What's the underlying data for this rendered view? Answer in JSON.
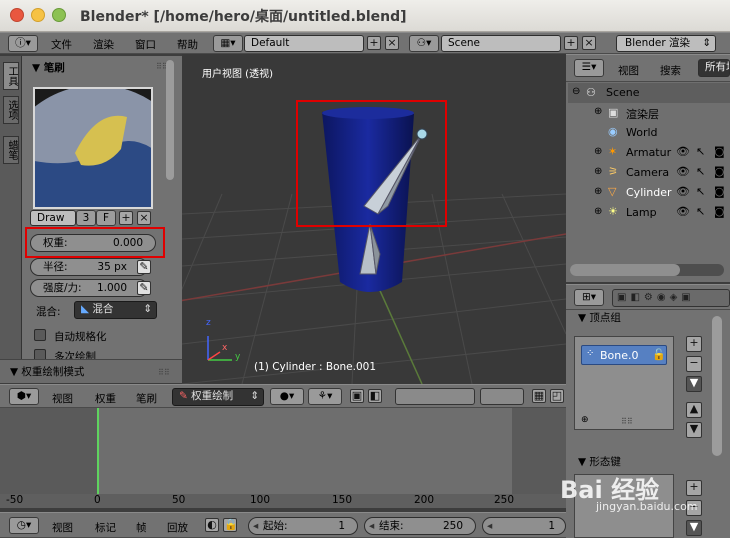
{
  "window": {
    "title": "Blender* [/home/hero/桌面/untitled.blend]"
  },
  "top_menu": {
    "items": [
      "文件",
      "渲染",
      "窗口",
      "帮助"
    ],
    "layout": "Default",
    "scene": "Scene",
    "engine": "Blender 渲染"
  },
  "tool_shelf": {
    "tabs": [
      "工具",
      "选项",
      "蜡笔"
    ],
    "brush_panel": "笔刷",
    "brush_name": "Draw",
    "brush_users": "3",
    "brush_fake": "F",
    "weight": {
      "label": "权重:",
      "value": "0.000"
    },
    "radius": {
      "label": "半径:",
      "value": "35 px"
    },
    "strength": {
      "label": "强度/力:",
      "value": "1.000"
    },
    "blend": {
      "label": "混合:",
      "value": "混合"
    },
    "auto_normalize": "自动规格化",
    "multi_paint": "多次绘制",
    "mode_panel": "权重绘制模式"
  },
  "viewport": {
    "view_label": "用户视图 (透视)",
    "status": "(1) Cylinder : Bone.001",
    "header": {
      "menus": [
        "视图",
        "权重",
        "笔刷"
      ],
      "mode": "权重绘制"
    }
  },
  "outliner": {
    "menus": [
      "视图",
      "搜索",
      "所有场"
    ],
    "items": [
      {
        "label": "Scene",
        "icon": "scene-icon"
      },
      {
        "label": "渲染层",
        "icon": "render-layers-icon"
      },
      {
        "label": "World",
        "icon": "world-icon"
      },
      {
        "label": "Armatur",
        "icon": "armature-icon"
      },
      {
        "label": "Camera",
        "icon": "camera-icon"
      },
      {
        "label": "Cylinder",
        "icon": "mesh-icon"
      },
      {
        "label": "Lamp",
        "icon": "lamp-icon"
      }
    ]
  },
  "properties": {
    "vertex_groups_panel": "顶点组",
    "group": "Bone.0",
    "shape_keys_panel": "形态键"
  },
  "timeline": {
    "ruler": [
      "-50",
      "0",
      "50",
      "100",
      "150",
      "200",
      "250"
    ],
    "menus": [
      "视图",
      "标记",
      "帧",
      "回放"
    ],
    "start": {
      "label": "起始:",
      "value": "1"
    },
    "end": {
      "label": "结束:",
      "value": "250"
    },
    "current": "1"
  },
  "watermark": {
    "text": "Bai 经验",
    "sub": "jingyan.baidu.com"
  }
}
